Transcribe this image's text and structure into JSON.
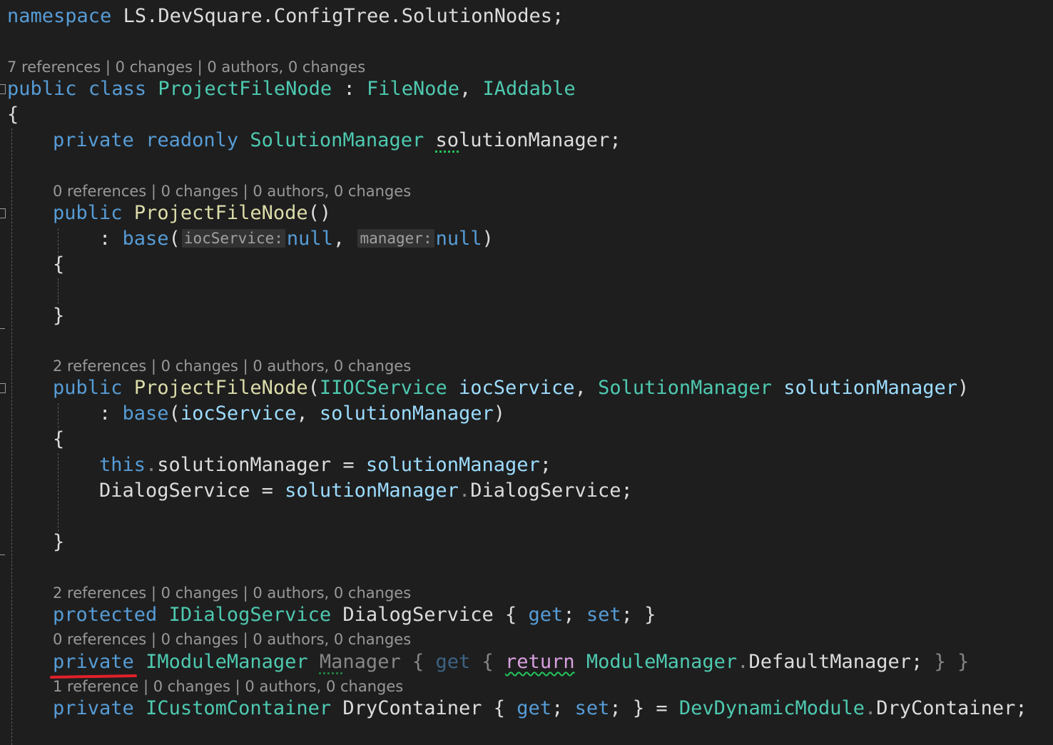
{
  "code": {
    "namespace_line": {
      "kw": "namespace",
      "name": "LS.DevSquare.ConfigTree.SolutionNodes",
      "semi": ";"
    },
    "class_lens": "7 references | 0 changes | 0 authors, 0 changes",
    "class_decl": {
      "kw1": "public",
      "kw2": "class",
      "name": "ProjectFileNode",
      "colon": " : ",
      "base1": "FileNode",
      "comma": ", ",
      "base2": "IAddable"
    },
    "open_brace": "{",
    "close_brace": "}",
    "field_line": {
      "kw1": "private",
      "kw2": "readonly",
      "type": "SolutionManager",
      "name_a": "so",
      "name_b": "lutionManager",
      "semi": ";"
    },
    "ctor1_lens": "0 references | 0 changes | 0 authors, 0 changes",
    "ctor1_decl": {
      "kw": "public",
      "name": "ProjectFileNode",
      "parens": "()"
    },
    "ctor1_base": {
      "colon": ": ",
      "kw": "base",
      "open": "(",
      "hint1": "iocService:",
      "null1": "null",
      "comma": ", ",
      "hint2": "manager:",
      "null2": "null",
      "close": ")"
    },
    "ctor2_lens": "2 references | 0 changes | 0 authors, 0 changes",
    "ctor2_decl": {
      "kw": "public",
      "name": "ProjectFileNode",
      "open": "(",
      "type1": "IIOCService",
      "param1": "iocService",
      "comma": ", ",
      "type2": "SolutionManager",
      "param2": "solutionManager",
      "close": ")"
    },
    "ctor2_base": {
      "colon": ": ",
      "kw": "base",
      "open": "(",
      "arg1": "iocService",
      "comma": ", ",
      "arg2": "solutionManager",
      "close": ")"
    },
    "ctor2_body1": {
      "kw": "this",
      "dot": ".",
      "member": "solutionManager",
      "eq": " = ",
      "value": "solutionManager",
      "semi": ";"
    },
    "ctor2_body2": {
      "member": "DialogService",
      "eq": " = ",
      "obj": "solutionManager",
      "dot": ".",
      "prop": "DialogService",
      "semi": ";"
    },
    "prop1_lens": "2 references | 0 changes | 0 authors, 0 changes",
    "prop1_decl": {
      "kw": "protected",
      "type": "IDialogService",
      "name": "DialogService",
      "open": " { ",
      "get": "get",
      "semi1": "; ",
      "set": "set",
      "semi2": "; ",
      "close": "}"
    },
    "prop2_lens": "0 references | 0 changes | 0 authors, 0 changes",
    "prop2_decl": {
      "kw": "private",
      "type": "IModuleManager",
      "name_a": "Ma",
      "name_b": "nager",
      "open": " { ",
      "get": "get",
      "open2": " { ",
      "ret": "return",
      "cls": "ModuleManager",
      "dot": ".",
      "prop": "DefaultManager",
      "semi": "; ",
      "close": "} }"
    },
    "prop3_lens": "1 reference | 0 changes | 0 authors, 0 changes",
    "prop3_decl": {
      "kw": "private",
      "type": "ICustomContainer",
      "name": "DryContainer",
      "open": " { ",
      "get": "get",
      "semi1": "; ",
      "set": "set",
      "semi2": "; ",
      "close": "} = ",
      "cls": "DevDynamicModule",
      "dot": ".",
      "prop": "DryContainer",
      "semi": ";"
    }
  },
  "colors": {
    "background": "#1e1e1e",
    "keyword": "#569cd6",
    "type": "#4ec9b0",
    "method": "#dcdcaa",
    "parameter": "#9cdcfe",
    "control": "#d8a0df",
    "annotation_mark": "#e0202a"
  }
}
